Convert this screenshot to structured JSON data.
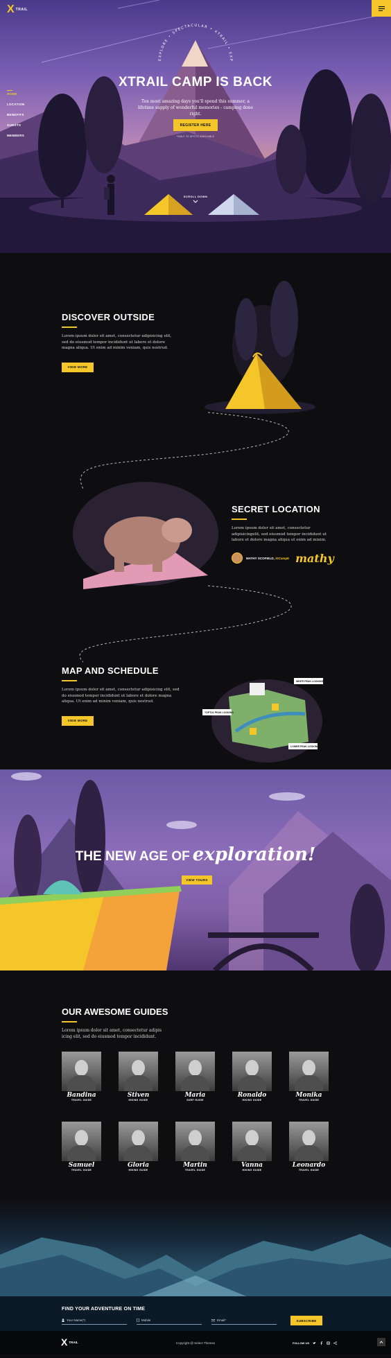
{
  "brand": {
    "mark": "X",
    "name": "TRAIL"
  },
  "nav": {
    "items": [
      "HOME",
      "LOCATION",
      "BENEFITS",
      "GUESTS",
      "MEMBERS"
    ],
    "active_index": 0
  },
  "hero": {
    "arc_text": "EXPLORE • SPECTACULAR • XTRAIL • EXPEDITION •",
    "title": "XTRAIL CAMP IS BACK",
    "text": "Ten most amazing days you'll spend this summer, a lifetime supply of wonderful memories - camping done right.",
    "button": "REGISTER HERE",
    "sub": "*ONLY 70 SPOTS AVAILABLE",
    "scroll": "SCROLL DOWN"
  },
  "features": [
    {
      "title": "DISCOVER OUTSIDE",
      "text": "Lorem ipsum dolor sit amet, consectetur adipisicing elit, sed do eiusmod tempor incididunt ut labore et dolore magna aliqua. Ut enim ad minim veniam, quis nostrud.",
      "button": "VIEW MORE"
    },
    {
      "title": "SECRET LOCATION",
      "text": "Lorem ipsum dolor sit amet, consectetur adipisicingelit, sed eiusmod tempor incididunt ut labore et dolore magna aliqua ut enim ad minim.",
      "author_name": "MATHY SCOFIELD,",
      "author_role": "XtCampE",
      "signature": "mathy"
    },
    {
      "title": "MAP AND SCHEDULE",
      "text": "Lorem ipsum dolor sit amet, consectetur adipisicing elit, sed do eiusmod tempor incididunt ut labore et dolore magna aliqua. Ut enim ad minim veniam, quis nostrud.",
      "button": "VIEW MORE",
      "map_labels": [
        "TOPTUL PEAK LOOKING",
        "WHITE PEAK LOOKING",
        "LOWER PEAK LOOKING"
      ]
    }
  ],
  "explore": {
    "title": "THE NEW AGE OF",
    "script": "exploration!",
    "button": "VIEW TOURS"
  },
  "guides": {
    "title": "OUR AWESOME GUIDES",
    "text": "Lorem ipsum dolor sit amet, consectetur adipis icing elit, sed do eiusmod tempor incididunt.",
    "people": [
      {
        "name": "Bandina",
        "role": "TRAVEL GUIDE"
      },
      {
        "name": "Stiven",
        "role": "HIKING GUIDE"
      },
      {
        "name": "Maria",
        "role": "SURF GUIDE"
      },
      {
        "name": "Ronaldo",
        "role": "HIKING GUIDE"
      },
      {
        "name": "Monika",
        "role": "TRAVEL GUIDE"
      },
      {
        "name": "Samuel",
        "role": "TRAVEL GUIDE"
      },
      {
        "name": "Gloria",
        "role": "HIKING GUIDE"
      },
      {
        "name": "Martin",
        "role": "TRAVEL GUIDE"
      },
      {
        "name": "Vanna",
        "role": "HIKING GUIDE"
      },
      {
        "name": "Leonardo",
        "role": "TRAVEL GUIDE"
      }
    ]
  },
  "signup": {
    "title": "FIND YOUR ADVENTURE ON TIME",
    "name_placeholder": "Your Name(*)",
    "mobile_placeholder": "Mobile",
    "email_placeholder": "Email*",
    "button": "SUBSCRIBE"
  },
  "footer": {
    "copyright": "Copyright @ Select Themes",
    "follow": "FOLLOW US"
  },
  "colors": {
    "accent": "#f5c629",
    "dark": "#0e0e10"
  }
}
